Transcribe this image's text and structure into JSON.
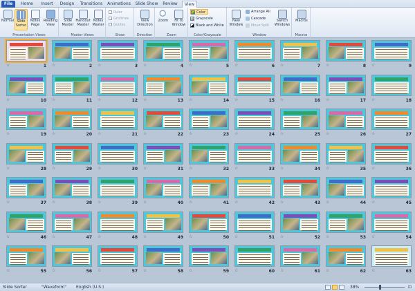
{
  "tabs": [
    "File",
    "Home",
    "Insert",
    "Design",
    "Transitions",
    "Animations",
    "Slide Show",
    "Review",
    "View"
  ],
  "active_tab": "View",
  "ribbon": {
    "presentation_views": {
      "label": "Presentation Views",
      "normal": "Normal",
      "slide_sorter": "Slide Sorter",
      "notes_page": "Notes Page",
      "reading_view": "Reading View"
    },
    "master_views": {
      "label": "Master Views",
      "slide_master": "Slide Master",
      "handout_master": "Handout Master",
      "notes_master": "Notes Master"
    },
    "show": {
      "label": "Show",
      "ruler": "Ruler",
      "gridlines": "Gridlines",
      "guides": "Guides"
    },
    "direction": {
      "label": "Direction",
      "view_direction": "View Direction"
    },
    "zoom": {
      "label": "Zoom",
      "zoom": "Zoom",
      "fit_to_window": "Fit to Window"
    },
    "color": {
      "label": "Color/Grayscale",
      "color": "Color",
      "grayscale": "Grayscale",
      "black_and_white": "Black and White"
    },
    "window": {
      "label": "Window",
      "new_window": "New Window",
      "arrange_all": "Arrange All",
      "cascade": "Cascade",
      "move_split": "Move Split",
      "switch_windows": "Switch Windows"
    },
    "macros": {
      "label": "Macros",
      "macros": "Macros"
    }
  },
  "slides": {
    "count": 63,
    "selected": 1
  },
  "status": {
    "view": "Slide Sorter",
    "theme": "\"Waveform\"",
    "language": "English (U.S.)",
    "zoom": "38%"
  },
  "colors": {
    "accent_selected": "#f2b134",
    "slide_background": "#4fc6d9",
    "file_tab": "#2a5bb4"
  }
}
